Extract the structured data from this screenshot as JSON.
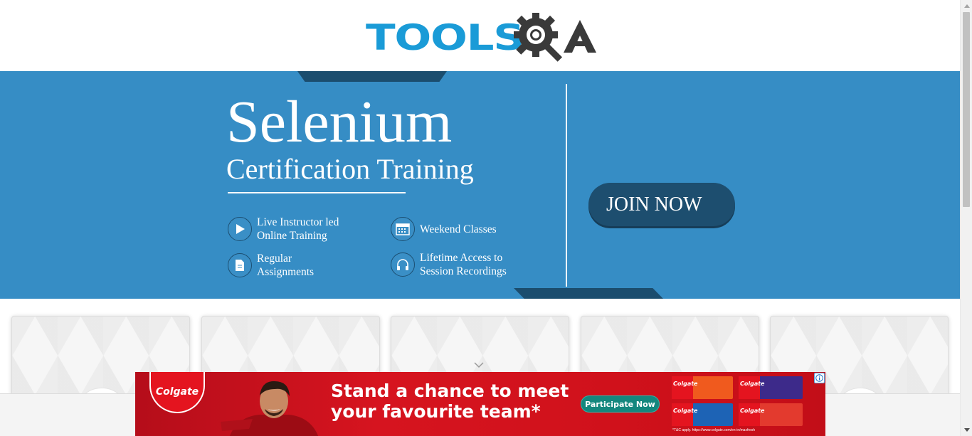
{
  "header": {
    "logo_text": "TOOLSQA"
  },
  "banner": {
    "title": "Selenium",
    "subtitle": "Certification Training",
    "features": [
      {
        "line1": "Live Instructor led",
        "line2": "Online Training",
        "icon": "play-icon"
      },
      {
        "line1": "Weekend Classes",
        "line2": "",
        "icon": "calendar-icon"
      },
      {
        "line1": "Regular",
        "line2": "Assignments",
        "icon": "document-icon"
      },
      {
        "line1": "Lifetime Access to",
        "line2": "Session Recordings",
        "icon": "headphones-icon"
      }
    ],
    "join_label": "JOIN NOW",
    "colors": {
      "background": "#368dc5",
      "accent_dark": "#1d4e6f"
    }
  },
  "cards": {
    "count": 5,
    "expand_icon": "chevron-down-icon"
  },
  "ad": {
    "brand": "Colgate",
    "headline_line1": "Stand a chance to meet",
    "headline_line2": "your favourite team*",
    "cta_label": "Participate Now",
    "terms": "*T&C apply. https://www.colgate.com/en-in/maxfresh",
    "info_icon": "info-icon"
  }
}
